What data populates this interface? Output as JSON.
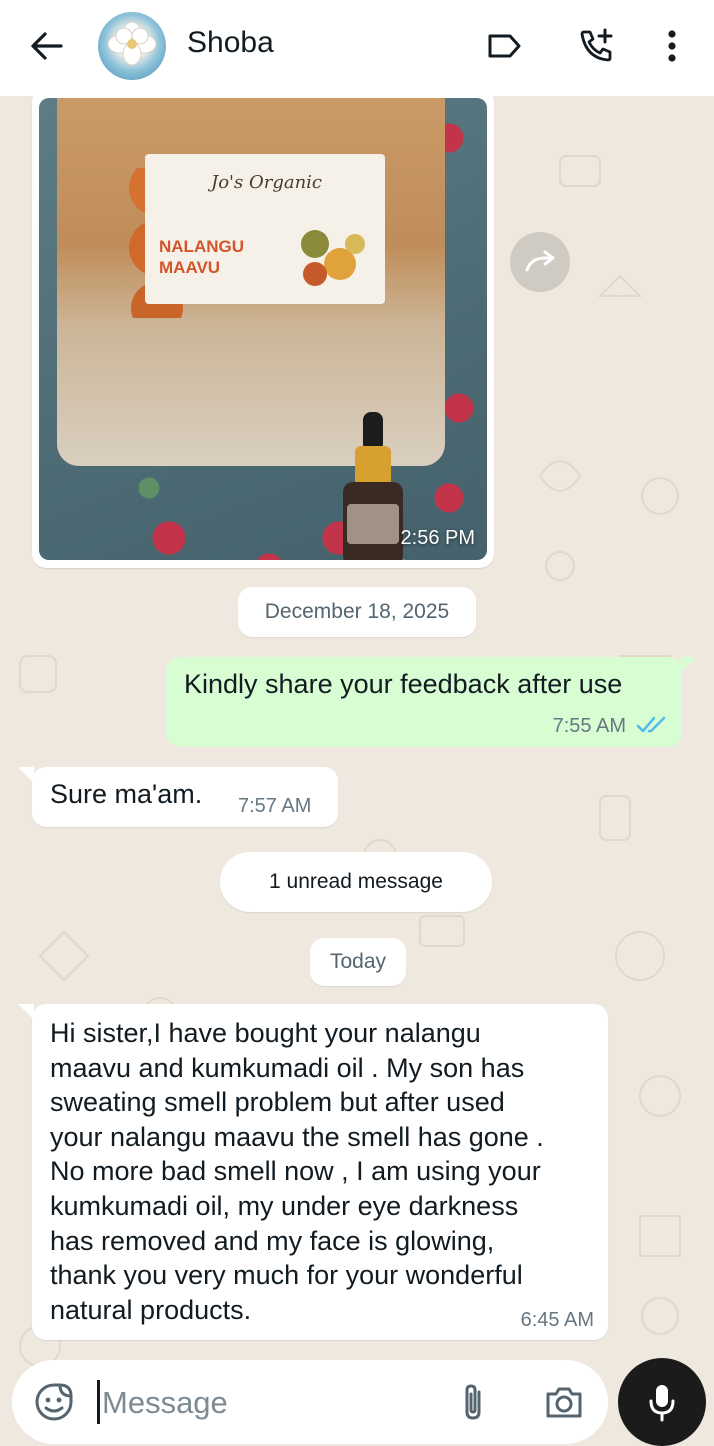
{
  "header": {
    "contact_name": "Shoba",
    "icons": [
      "back-arrow-icon",
      "label-tag-icon",
      "add-call-icon",
      "more-vert-icon"
    ]
  },
  "product_photo": {
    "brand": "Jo's Organic",
    "product": "NALANGU MAAVU",
    "time": "2:56 PM"
  },
  "date_separator": "December 18, 2025",
  "outgoing_message": {
    "text": "Kindly share your feedback after use",
    "time": "7:55 AM",
    "status": "read"
  },
  "incoming_message_1": {
    "text": "Sure ma'am.",
    "time": "7:57 AM"
  },
  "unread_banner": "1 unread message",
  "today_separator": "Today",
  "incoming_message_2": {
    "lines": [
      "Hi sister,I have bought your nalangu",
      "maavu and kumkumadi oil . My son has",
      "sweating smell problem but after used",
      "your nalangu maavu the smell has gone .",
      "No more bad smell now , I am using your",
      "kumkumadi oil, my under eye darkness",
      "has removed and my face is glowing,",
      "thank you very much for your wonderful",
      "natural products."
    ],
    "time": "6:45 AM"
  },
  "composer": {
    "placeholder": "Message",
    "value": ""
  },
  "colors": {
    "chat_background": "#efe8de",
    "outgoing_bubble": "#d9fdd3",
    "incoming_bubble": "#ffffff",
    "read_ticks": "#53bdeb",
    "mic_button": "#1b1b1b"
  }
}
